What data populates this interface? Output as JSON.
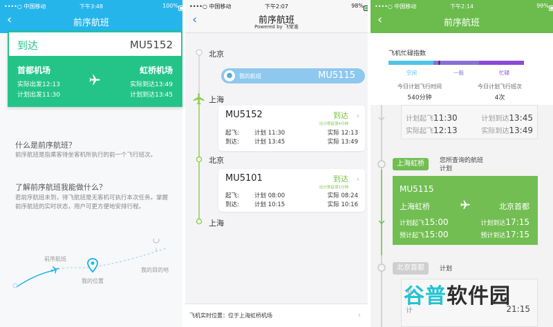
{
  "panel1": {
    "status": {
      "carrier": "••••○ 中国移动",
      "time": "下午3:48",
      "battery": "100%"
    },
    "nav": {
      "title": "前序航班"
    },
    "arrival": {
      "status": "到达",
      "flight_no": "MU5152"
    },
    "route": {
      "from": "首都机场",
      "to": "虹桥机场",
      "actual_departure": "实际出发12:13",
      "planned_departure": "计划出发11:30",
      "actual_arrival": "实际到达13:49",
      "planned_arrival": "计划到达13:45"
    },
    "faq": [
      {
        "q": "什么是前序航班？",
        "a": "前序航班是指乘客待坐客机所执行的前一个飞行班次。"
      },
      {
        "q": "了解前序航班我能做什么？",
        "a": "若前序航班未到，待飞航班是无客机可执行本次任务。掌握前序航班的实时状态，用户可更方便地安排行程。"
      }
    ],
    "illustration": {
      "label_prev": "前序航班",
      "label_my": "我的位置",
      "label_dest": "我的目的地"
    }
  },
  "panel2": {
    "status": {
      "carrier": "••••○ 中国移动",
      "time": "下午2:07",
      "battery": "98%"
    },
    "nav": {
      "title": "前序航班",
      "subtitle": "Powered by 飞常准"
    },
    "timeline": [
      {
        "city": "北京"
      },
      {
        "city": "上海"
      },
      {
        "city": "北京"
      },
      {
        "city": "上海"
      }
    ],
    "my_flight": {
      "label": "我的航班",
      "flight_no": "MU5115"
    },
    "flights": [
      {
        "flight_no": "MU5152",
        "status": "到达",
        "status_sub": "比计划延误4分钟",
        "dep_label": "起飞:",
        "arr_label": "到达:",
        "plan_dep": "计划 11:30",
        "act_dep": "实际 12:13",
        "plan_arr": "计划 13:45",
        "act_arr": "实际 13:49"
      },
      {
        "flight_no": "MU5101",
        "status": "到达",
        "status_sub": "比计划延误1分钟",
        "dep_label": "起飞:",
        "arr_label": "到达:",
        "plan_dep": "计划 08:00",
        "act_dep": "实际 08:24",
        "plan_arr": "计划 10:15",
        "act_arr": "实际 10:16"
      }
    ],
    "bottom": {
      "text": "飞机实时位置：位于上海虹桥机场"
    }
  },
  "panel3": {
    "status": {
      "carrier": "••••○ 中国移动",
      "time": "下午2:14",
      "battery": "99%"
    },
    "nav": {
      "title": "前序航班"
    },
    "busy": {
      "title": "飞机忙碌指数",
      "levels": [
        "空闲",
        "一般",
        "忙碌"
      ],
      "level_colors": [
        "#4fc3e8",
        "#8a6fd8",
        "#8a4bd6"
      ],
      "marker": 0.37,
      "flight_time_label": "今日计划飞行时间",
      "flight_time_value": "540分钟",
      "flight_count_label": "今日计划飞行班次",
      "flight_count_value": "4次"
    },
    "prev_card": {
      "plan_dep_label": "计划起飞",
      "plan_dep": "11:30",
      "act_dep_label": "实际起飞",
      "act_dep": "12:13",
      "plan_arr_label": "计划到达",
      "plan_arr": "13:45",
      "act_arr_label": "实际到达",
      "act_arr": "13:49"
    },
    "tag1": {
      "city": "上海虹桥",
      "note_l1": "您所查询的航班",
      "note_l2": "计划"
    },
    "main_card": {
      "flight_no": "MU5115",
      "from": "上海虹桥",
      "to": "北京首都",
      "plan_dep_label": "计划起飞",
      "plan_dep": "15:00",
      "est_dep_label": "预计起飞",
      "est_dep": "15:00",
      "plan_arr_label": "计划到达",
      "plan_arr": "17:15",
      "est_arr_label": "预计到达",
      "est_arr": "17:15"
    },
    "tag2": {
      "city": "北京首都",
      "note": "计划"
    },
    "partial": {
      "left_text": "北",
      "left_text2": "计",
      "right_time": "21:15"
    },
    "watermark": {
      "part1": "谷普",
      "part2": "软件园"
    }
  }
}
